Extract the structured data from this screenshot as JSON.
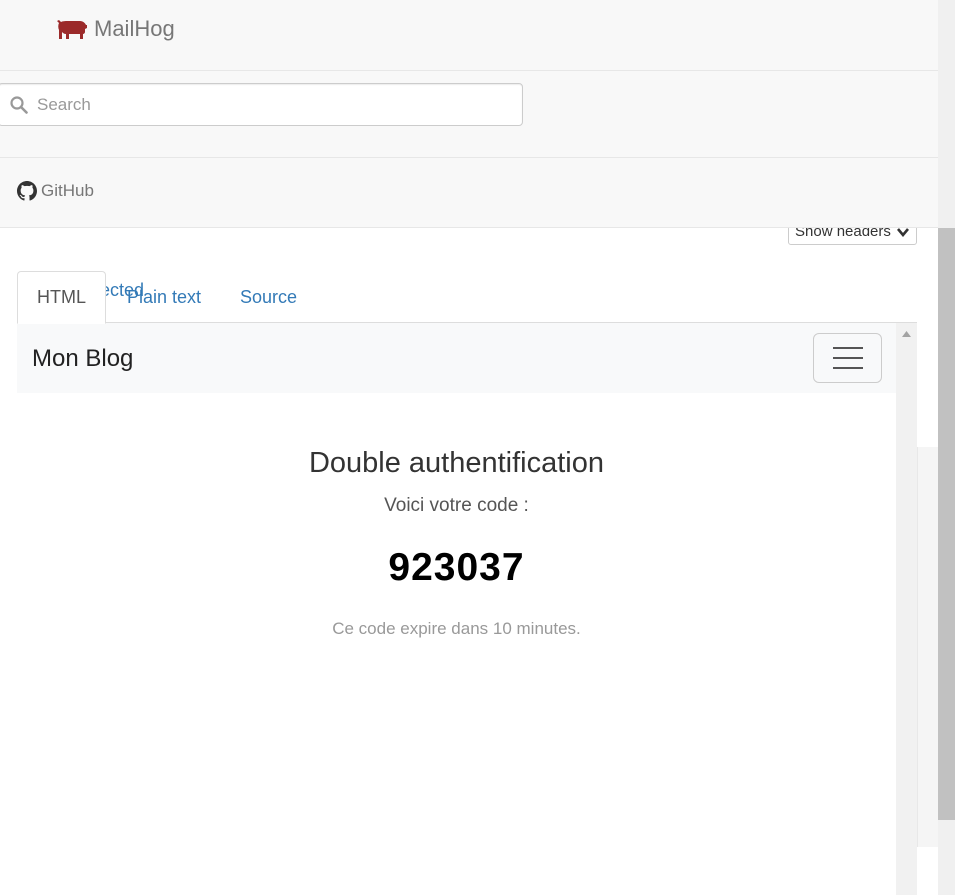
{
  "navbar": {
    "brand_label": "MailHog",
    "search_placeholder": "Search",
    "github_label": "GitHub"
  },
  "message": {
    "show_headers_label": "Show headers",
    "ghost_text": "ected",
    "tabs": [
      {
        "label": "HTML",
        "active": true
      },
      {
        "label": "Plain text",
        "active": false
      },
      {
        "label": "Source",
        "active": false
      }
    ]
  },
  "email": {
    "blog_brand": "Mon Blog",
    "title": "Double authentification",
    "subtitle": "Voici votre code :",
    "code": "923037",
    "expire_note": "Ce code expire dans 10 minutes."
  },
  "colors": {
    "brand_icon": "#9b2a2a",
    "link": "#337ab7",
    "navbar_bg": "#f8f8f8"
  }
}
